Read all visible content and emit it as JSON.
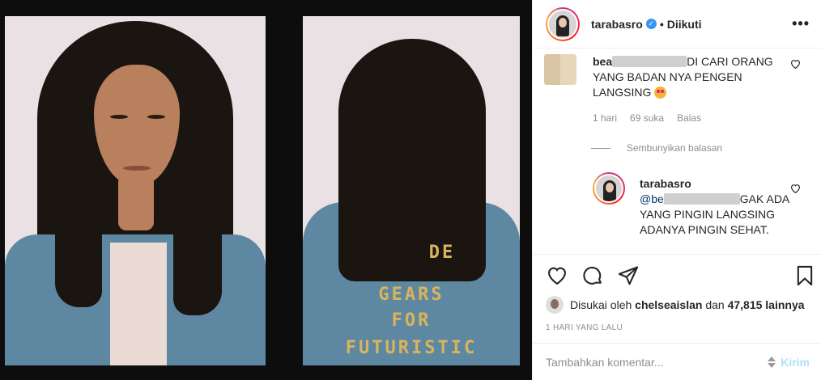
{
  "header": {
    "username": "tarabasro",
    "follow_status": "Diikuti"
  },
  "comment": {
    "username_prefix": "bea",
    "text_after_blur": "DI CARI ORANG YANG BADAN NYA PENGEN LANGSING",
    "emoji": "star-struck-emoji",
    "time": "1 hari",
    "likes": "69 suka",
    "reply_label": "Balas"
  },
  "hide_replies": "Sembunyikan balasan",
  "reply": {
    "username": "tarabasro",
    "mention_prefix": "@be",
    "text": "GAK ADA YANG PINGIN LANGSING ADANYA PINGIN SEHAT."
  },
  "photo": {
    "jacket_lines": [
      "GEARS",
      "FOR",
      "FUTURISTIC"
    ],
    "jacket_partial": "DE"
  },
  "likes": {
    "prefix": "Disukai oleh",
    "user": "chelseaislan",
    "conj": "dan",
    "count": "47,815 lainnya"
  },
  "timestamp": "1 HARI YANG LALU",
  "add_comment": {
    "placeholder": "Tambahkan komentar...",
    "post_label": "Kirim"
  },
  "colors": {
    "verified": "#3897f0",
    "post_disabled": "#b2dffc",
    "muted": "#8e8e8e"
  },
  "icons": [
    "heart-icon",
    "comment-icon",
    "share-icon",
    "save-icon",
    "more-icon",
    "verified-icon"
  ]
}
